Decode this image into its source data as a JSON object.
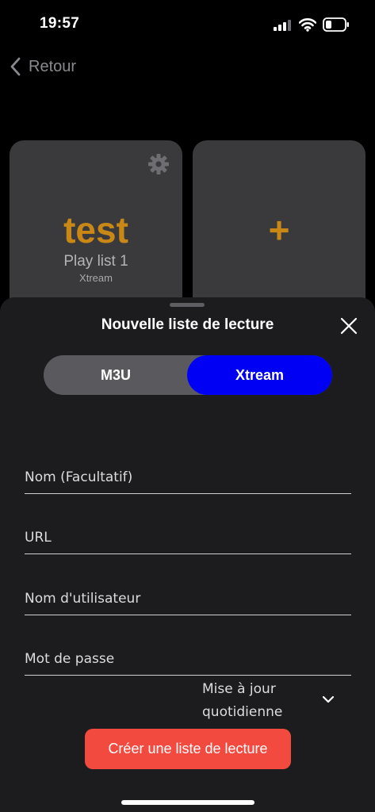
{
  "status": {
    "time": "19:57",
    "icons": [
      "signal-icon",
      "wifi-icon",
      "battery-icon"
    ]
  },
  "nav": {
    "back_label": "Retour",
    "icon": "chevron-left-icon"
  },
  "playlists": [
    {
      "title": "test",
      "subtitle": "Play list 1",
      "type": "Xtream",
      "icon": "gear-icon"
    },
    {
      "label": "+"
    }
  ],
  "sheet": {
    "title": "Nouvelle liste de lecture",
    "close_icon": "close-icon",
    "segments": [
      "M3U",
      "Xtream"
    ],
    "selected_segment": "Xtream",
    "fields": [
      {
        "placeholder": "Nom (Facultatif)",
        "value": ""
      },
      {
        "placeholder": "URL",
        "value": ""
      },
      {
        "placeholder": "Nom d'utilisateur",
        "value": ""
      },
      {
        "placeholder": "Mot de passe",
        "value": ""
      }
    ],
    "update_frequency": "Mise à jour quotidienne",
    "create_label": "Créer une liste de lecture"
  },
  "colors": {
    "accent_orange": "#c98816",
    "selected_segment": "#0000f5",
    "create_button": "#f24a3f",
    "sheet_background": "#1c1c1e",
    "card_background": "#3a3a3c"
  }
}
